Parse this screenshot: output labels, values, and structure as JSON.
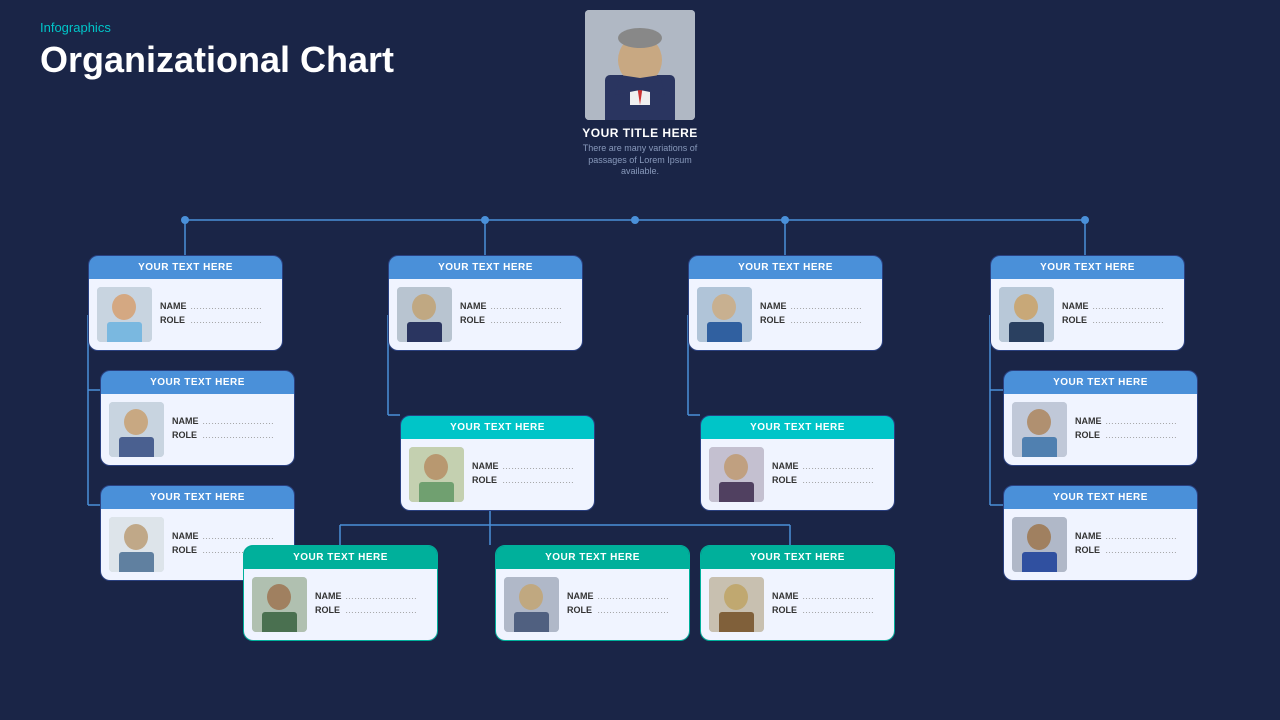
{
  "header": {
    "infographics": "Infographics",
    "title": "Organizational Chart"
  },
  "topCard": {
    "titleLabel": "YOUR TITLE HERE",
    "desc": "There are many variations of passages of Lorem Ipsum available."
  },
  "cards": {
    "col1_row1": {
      "header": "YOUR TEXT HERE",
      "name_label": "NAME",
      "role_label": "ROLE",
      "name_dots": "……………………",
      "role_dots": "……………………"
    },
    "col1_row2": {
      "header": "YOUR TEXT HERE",
      "name_label": "NAME",
      "role_label": "ROLE",
      "name_dots": "……………………",
      "role_dots": "……………………"
    },
    "col1_row3": {
      "header": "YOUR TEXT HERE",
      "name_label": "NAME",
      "role_label": "ROLE",
      "name_dots": "……………………",
      "role_dots": "……………………"
    },
    "col2_row1": {
      "header": "YOUR TEXT HERE",
      "name_label": "NAME",
      "role_label": "ROLE",
      "name_dots": "……………………",
      "role_dots": "……………………"
    },
    "col2_row2": {
      "header": "YOUR TEXT HERE",
      "name_label": "NAME",
      "role_label": "ROLE",
      "name_dots": "……………………",
      "role_dots": "……………………"
    },
    "col2_bot1": {
      "header": "YOUR TEXT HERE",
      "name_label": "NAME",
      "role_label": "ROLE",
      "name_dots": "……………………",
      "role_dots": "……………………"
    },
    "col2_bot2": {
      "header": "YOUR TEXT HERE",
      "name_label": "NAME",
      "role_label": "ROLE",
      "name_dots": "……………………",
      "role_dots": "……………………"
    },
    "col2_bot3": {
      "header": "YOUR TEXT HERE",
      "name_label": "NAME",
      "role_label": "ROLE",
      "name_dots": "……………………",
      "role_dots": "……………………"
    },
    "col3_row1": {
      "header": "YOUR TEXT HERE",
      "name_label": "NAME",
      "role_label": "ROLE",
      "name_dots": "……………………",
      "role_dots": "……………………"
    },
    "col3_row2": {
      "header": "YOUR TEXT HERE",
      "name_label": "NAME",
      "role_label": "ROLE",
      "name_dots": "……………………",
      "role_dots": "……………………"
    },
    "col4_row1": {
      "header": "YOUR TEXT HERE",
      "name_label": "NAME",
      "role_label": "ROLE",
      "name_dots": "……………………",
      "role_dots": "……………………"
    },
    "col4_row2": {
      "header": "YOUR TEXT HERE",
      "name_label": "NAME",
      "role_label": "ROLE",
      "name_dots": "……………………",
      "role_dots": "……………………"
    },
    "col4_row3": {
      "header": "YOUR TEXT HERE",
      "name_label": "NAME",
      "role_label": "ROLE",
      "name_dots": "……………………",
      "role_dots": "……………………"
    }
  }
}
